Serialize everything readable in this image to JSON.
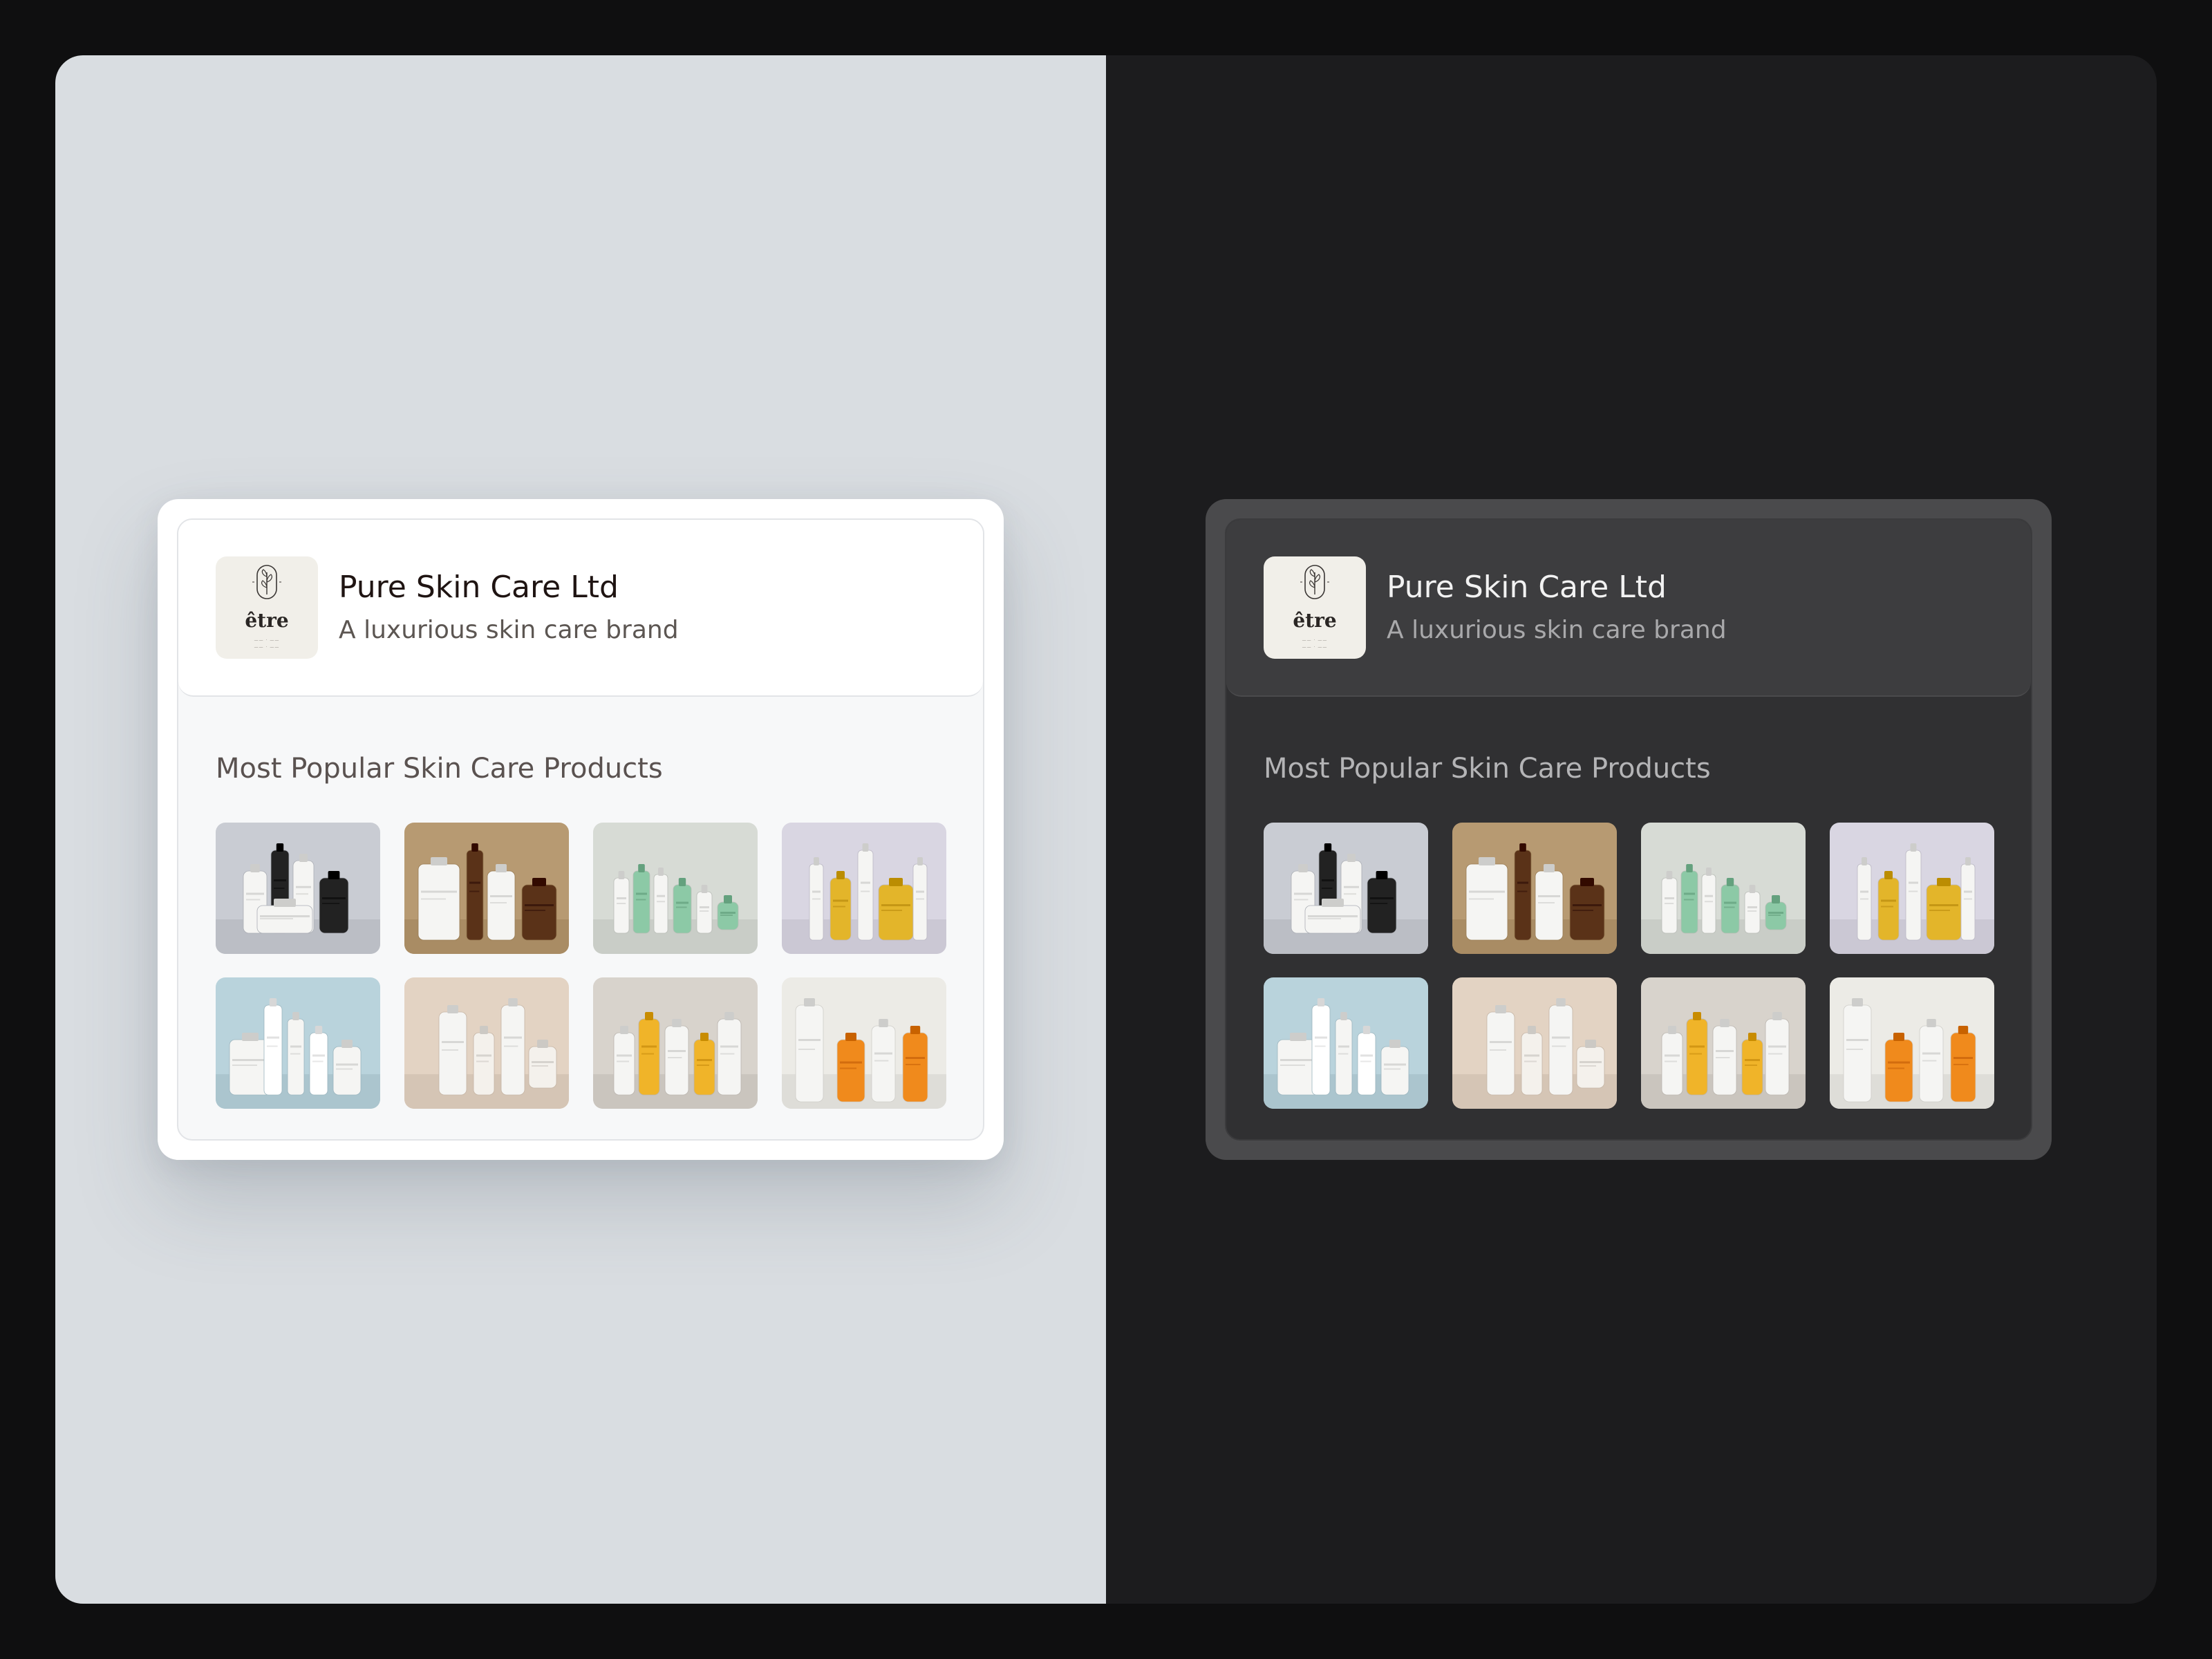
{
  "themes": [
    {
      "id": "light"
    },
    {
      "id": "dark"
    }
  ],
  "brand": {
    "name": "Pure Skin Care Ltd",
    "tagline": "A luxurious skin care brand",
    "logo": {
      "wordmark": "être",
      "icon": "botanical-leaf-icon"
    }
  },
  "section": {
    "title": "Most Popular Skin Care Products"
  },
  "products": [
    {
      "name": "product-1",
      "bg": "#c9ccd3",
      "accent": "#222222"
    },
    {
      "name": "product-2",
      "bg": "#b79a72",
      "accent": "#5a3218"
    },
    {
      "name": "product-3",
      "bg": "#d7dbd5",
      "accent": "#8cc9a6"
    },
    {
      "name": "product-4",
      "bg": "#d9d6e2",
      "accent": "#e3b52a"
    },
    {
      "name": "product-5",
      "bg": "#b9d3dc",
      "accent": "#ffffff"
    },
    {
      "name": "product-6",
      "bg": "#e3d3c3",
      "accent": "#f4f1ec"
    },
    {
      "name": "product-7",
      "bg": "#d8d3cc",
      "accent": "#f0b429"
    },
    {
      "name": "product-8",
      "bg": "#ecebe6",
      "accent": "#f08a1c"
    }
  ]
}
